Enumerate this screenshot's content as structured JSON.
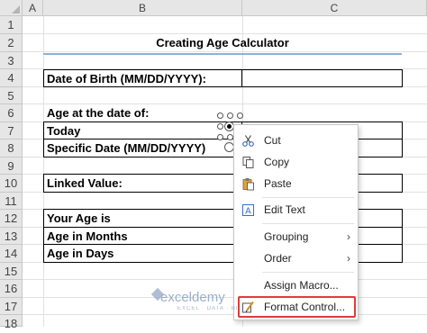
{
  "columns": [
    "A",
    "B",
    "C"
  ],
  "rows": [
    "1",
    "2",
    "3",
    "4",
    "5",
    "6",
    "7",
    "8",
    "9",
    "10",
    "11",
    "12",
    "13",
    "14",
    "15",
    "16",
    "17",
    "18"
  ],
  "sheet": {
    "title": "Creating Age Calculator",
    "date_of_birth": "Date of Birth (MM/DD/YYYY):",
    "age_at": "Age at the date of:",
    "today": "Today",
    "specific_date": "Specific Date (MM/DD/YYYY)",
    "linked_value": "Linked Value:",
    "your_age": "Your Age is",
    "age_months": "Age in Months",
    "age_days": "Age in Days"
  },
  "context_menu": {
    "cut": "Cut",
    "copy": "Copy",
    "paste": "Paste",
    "edit_text": "Edit Text",
    "grouping": "Grouping",
    "order": "Order",
    "assign_macro": "Assign Macro...",
    "format_control": "Format Control..."
  },
  "watermark": {
    "name": "exceldemy",
    "tagline": "EXCEL · DATA · BI"
  },
  "colors": {
    "highlight": "#e33a3a",
    "title_rule": "#8fb0d8",
    "header_bg": "#e6e6e6"
  }
}
